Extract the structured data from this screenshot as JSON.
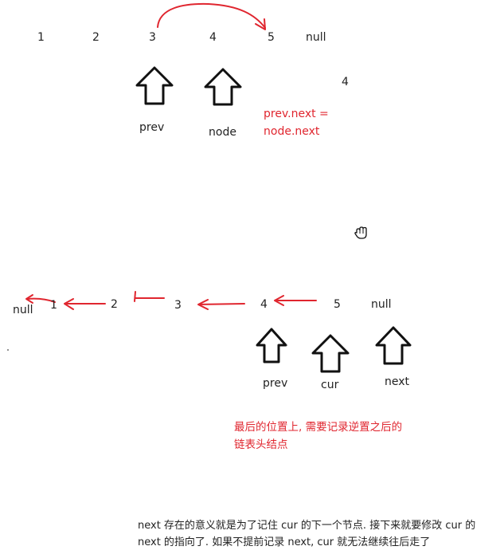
{
  "diagram_top": {
    "nodes": [
      "1",
      "2",
      "3",
      "4",
      "5",
      "null"
    ],
    "pointer_labels": [
      "prev",
      "node"
    ],
    "stray_label": "4",
    "annotation_line1": "prev.next =",
    "annotation_line2": "node.next"
  },
  "diagram_bottom": {
    "nodes": [
      "null",
      "1",
      "2",
      "3",
      "4",
      "5",
      "null"
    ],
    "pointer_labels": [
      "prev",
      "cur",
      "next"
    ],
    "red_note_line1": "最后的位置上, 需要记录逆置之后的",
    "red_note_line2": "链表头结点"
  },
  "explanation": {
    "line1": "next 存在的意义就是为了记住 cur 的下一个节点. 接下来就要修改 cur 的",
    "line2": "next 的指向了. 如果不提前记录 next, cur 就无法继续往后走了"
  },
  "colors": {
    "accent": "#e0262f",
    "text": "#222222"
  },
  "icons": [
    "hand-cursor-icon"
  ]
}
